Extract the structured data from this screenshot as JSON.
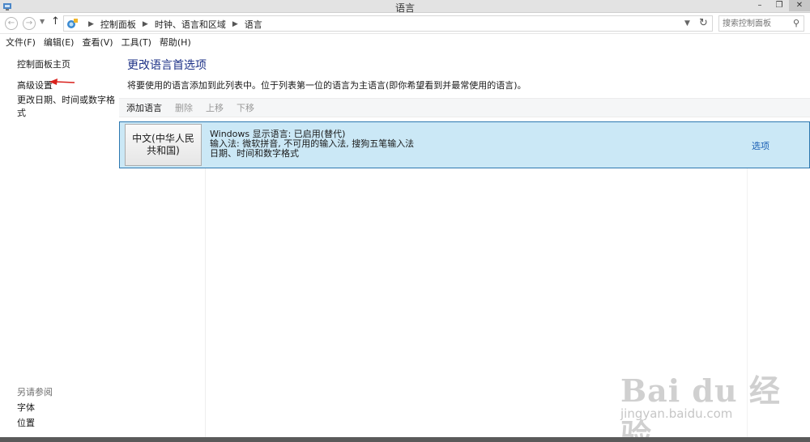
{
  "window": {
    "title": "语言",
    "min": "–",
    "max": "❐",
    "close": "✕"
  },
  "address": {
    "breadcrumbs": [
      "控制面板",
      "时钟、语言和区域",
      "语言"
    ],
    "search_placeholder": "搜索控制面板"
  },
  "menu": [
    "文件(F)",
    "编辑(E)",
    "查看(V)",
    "工具(T)",
    "帮助(H)"
  ],
  "sidebar": {
    "home": "控制面板主页",
    "advanced": "高级设置",
    "datetime": "更改日期、时间或数字格式",
    "see_also": "另请参阅",
    "fonts": "字体",
    "location": "位置"
  },
  "main": {
    "title": "更改语言首选项",
    "description": "将要使用的语言添加到此列表中。位于列表第一位的语言为主语言(即你希望看到并最常使用的语言)。",
    "toolbar": {
      "add": "添加语言",
      "remove": "删除",
      "up": "上移",
      "down": "下移"
    },
    "languages": [
      {
        "name": "中文(中华人民共和国)",
        "line1": "Windows 显示语言: 已启用(替代)",
        "line2": "输入法: 微软拼音, 不可用的输入法, 搜狗五笔输入法",
        "line3": "日期、时间和数字格式",
        "options": "选项"
      }
    ]
  },
  "watermark": {
    "big": "Bai du 经验",
    "small": "jingyan.baidu.com"
  },
  "colors": {
    "accent_title": "#1e3287",
    "selection_bg": "#cbe8f6",
    "selection_border": "#2d78b0",
    "link": "#1a5fb4",
    "arrow": "#d9211c"
  }
}
